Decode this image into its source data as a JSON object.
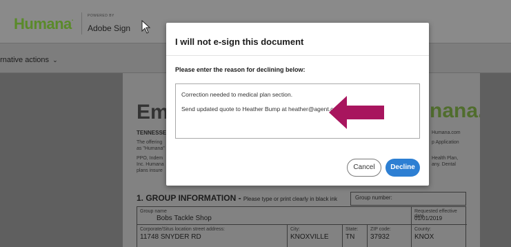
{
  "header": {
    "logo_text": "Humana",
    "powered_by": "POWERED BY",
    "brand": "Adobe Sign"
  },
  "actions": {
    "label": "ernative actions"
  },
  "document": {
    "title_partial": "Empl",
    "brand_partial": "nana.",
    "state_partial": "TENNESSEE",
    "left_lines": [
      "The offering",
      "as \"Humana\"",
      "PPO, Indem",
      "Inc. Humana",
      "plans insure"
    ],
    "right_lines": [
      "Humana.com",
      "p Application",
      "Health Plan,",
      "any. Dental"
    ],
    "section_title": "1. GROUP INFORMATION -",
    "section_sub": "Please type or print clearly in black ink",
    "group_number_label": "Group number:",
    "group_name_label": "Group name",
    "group_name_value": "Bobs Tackle Shop",
    "effective_label": "Requested effective date",
    "effective_value": "01/01/2019",
    "address_label": "Corporate/Situs location street address:",
    "address_value": "11748 SNYDER RD",
    "city_label": "City:",
    "city_value": "KNOXVILLE",
    "state_label": "State:",
    "state_value": "TN",
    "zip_label": "ZIP code:",
    "zip_value": "37932",
    "county_label": "County:",
    "county_value": "KNOX"
  },
  "modal": {
    "title": "I will not e-sign this document",
    "prompt": "Please enter the reason for declining below:",
    "reason_lines": [
      "Correction needed to medical plan section.",
      "Send updated quote to Heather Bump at heather@agent.com"
    ],
    "cancel_label": "Cancel",
    "decline_label": "Decline"
  },
  "colors": {
    "brand_green": "#5a8a2a",
    "decline_blue": "#2d7fd3",
    "arrow": "#a8155e"
  }
}
